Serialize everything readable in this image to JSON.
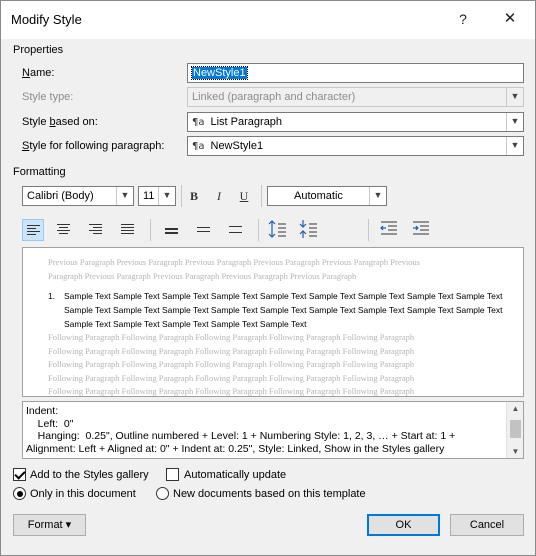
{
  "window": {
    "title": "Modify Style",
    "help": "?",
    "close": "✕"
  },
  "properties": {
    "section": "Properties",
    "name_label": "Name:",
    "name_value": "NewStyle1",
    "style_type_label": "Style type:",
    "style_type_value": "Linked (paragraph and character)",
    "based_on_label": "Style based on:",
    "based_on_value": "List Paragraph",
    "following_label": "Style for following paragraph:",
    "following_value": "NewStyle1",
    "para_glyph": "¶a"
  },
  "formatting": {
    "section": "Formatting",
    "font": "Calibri (Body)",
    "size": "11",
    "bold": "B",
    "italic": "I",
    "underline": "U",
    "color": "Automatic"
  },
  "preview": {
    "previous": [
      "Previous Paragraph Previous Paragraph Previous Paragraph Previous Paragraph Previous Paragraph Previous",
      "Paragraph Previous Paragraph Previous Paragraph Previous Paragraph Previous Paragraph"
    ],
    "number": "1.",
    "sample": [
      "Sample Text Sample Text Sample Text Sample Text Sample Text Sample Text Sample Text Sample Text Sample Text",
      "Sample Text Sample Text Sample Text Sample Text Sample Text Sample Text Sample Text Sample Text Sample Text",
      "Sample Text Sample Text Sample Text Sample Text Sample Text"
    ],
    "following": [
      "Following Paragraph Following Paragraph Following Paragraph Following Paragraph Following Paragraph",
      "Following Paragraph Following Paragraph Following Paragraph Following Paragraph Following Paragraph",
      "Following Paragraph Following Paragraph Following Paragraph Following Paragraph Following Paragraph",
      "Following Paragraph Following Paragraph Following Paragraph Following Paragraph Following Paragraph",
      "Following Paragraph Following Paragraph Following Paragraph Following Paragraph Following Paragraph"
    ]
  },
  "description": [
    "Indent:",
    "    Left:  0\"",
    "    Hanging:  0.25\", Outline numbered + Level: 1 + Numbering Style: 1, 2, 3, … + Start at: 1 +",
    "Alignment: Left + Aligned at:  0\" + Indent at:  0.25\", Style: Linked, Show in the Styles gallery"
  ],
  "options": {
    "add_gallery": "Add to the Styles gallery",
    "auto_update": "Automatically update",
    "only_doc": "Only in this document",
    "new_docs": "New documents based on this template"
  },
  "buttons": {
    "format": "Format ▾",
    "ok": "OK",
    "cancel": "Cancel"
  }
}
